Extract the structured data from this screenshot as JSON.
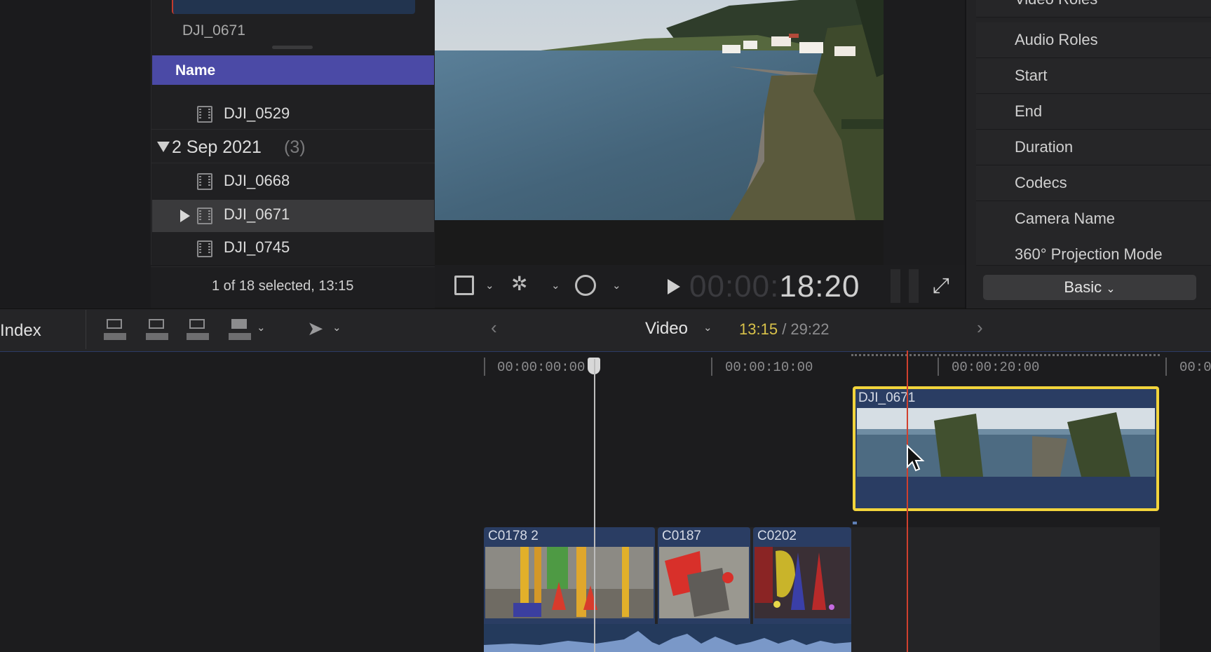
{
  "browser": {
    "top_clip_label": "DJI_0671",
    "column_header": "Name",
    "rows": [
      {
        "type": "clip",
        "label": "DJI_0529"
      },
      {
        "type": "group",
        "label": "2 Sep 2021",
        "count": "(3)"
      },
      {
        "type": "clip",
        "label": "DJI_0668"
      },
      {
        "type": "clip",
        "label": "DJI_0671",
        "selected": true
      },
      {
        "type": "clip",
        "label": "DJI_0745"
      }
    ],
    "status": "1 of 18 selected, 13:15"
  },
  "viewer": {
    "timecode_dim": "00:00:",
    "timecode_main": "18:20"
  },
  "inspector": {
    "fields": [
      "Video Roles",
      "Audio Roles",
      "Start",
      "End",
      "Duration",
      "Codecs",
      "Camera Name",
      "360° Projection Mode"
    ],
    "view_select": "Basic"
  },
  "timeline_toolbar": {
    "index_label": "Index",
    "view_label": "Video",
    "position": "13:15",
    "total": "/ 29:22"
  },
  "timeline": {
    "ruler": [
      "00:00:00:00",
      "00:00:10:00",
      "00:00:20:00",
      "00:0"
    ],
    "connected_clip": "DJI_0671",
    "storyline_clips": [
      "C0178 2",
      "C0187",
      "C0202"
    ]
  },
  "colors": {
    "accent": "#4b4aa6",
    "clip_blue": "#2a3d63",
    "selection_yellow": "#f2d43c",
    "skimmer_red": "#d0402e",
    "timecode_yellow": "#d9c24a"
  }
}
